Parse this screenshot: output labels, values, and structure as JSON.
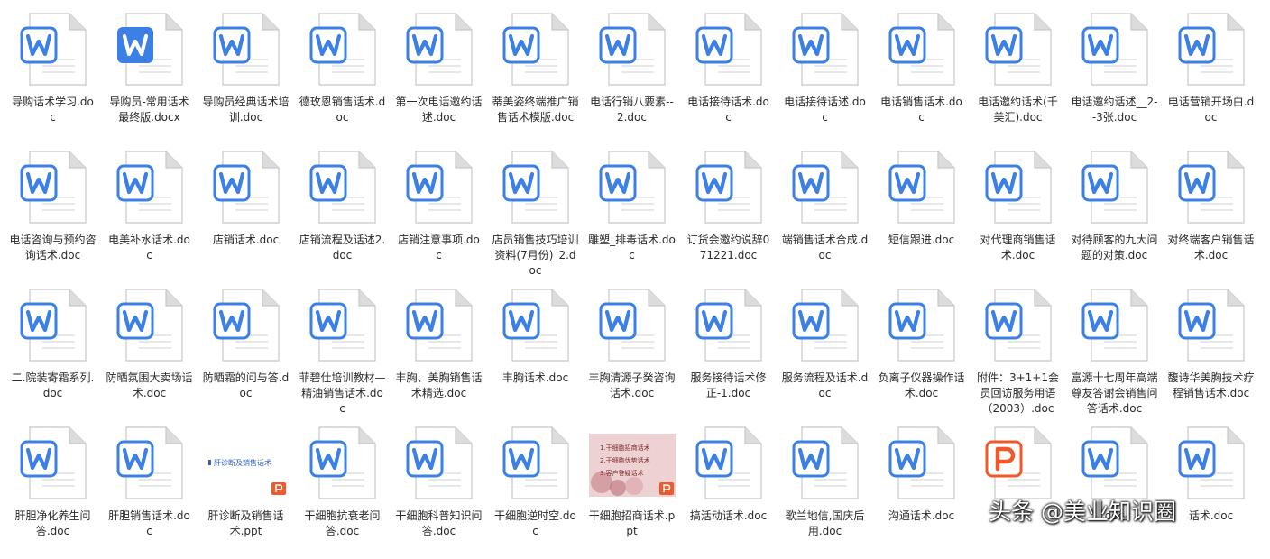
{
  "files": [
    {
      "name": "导购话术学习.doc",
      "type": "word"
    },
    {
      "name": "导购员-常用话术最终版.docx",
      "type": "word-filled"
    },
    {
      "name": "导购员经典话术培训.doc",
      "type": "word"
    },
    {
      "name": "德玫恩销售话术.doc",
      "type": "word"
    },
    {
      "name": "第一次电话邀约话述.doc",
      "type": "word"
    },
    {
      "name": "蒂美姿终端推广销售话术模版.doc",
      "type": "word"
    },
    {
      "name": "电话行销八要素--2.doc",
      "type": "word"
    },
    {
      "name": "电话接待话术.doc",
      "type": "word"
    },
    {
      "name": "电话接待话述.doc",
      "type": "word"
    },
    {
      "name": "电话销售话术.doc",
      "type": "word"
    },
    {
      "name": "电话邀约话术(千美汇).doc",
      "type": "word"
    },
    {
      "name": "电话邀约话述__2--3张.doc",
      "type": "word"
    },
    {
      "name": "电话营销开场白.doc",
      "type": "word"
    },
    {
      "name": "电话咨询与预约咨询话术.doc",
      "type": "word"
    },
    {
      "name": "电美补水话术.doc",
      "type": "word"
    },
    {
      "name": "店销话术.doc",
      "type": "word"
    },
    {
      "name": "店销流程及话述2.doc",
      "type": "word"
    },
    {
      "name": "店销注意事项.doc",
      "type": "word"
    },
    {
      "name": "店员销售技巧培训资料(7月份)_2.doc",
      "type": "word"
    },
    {
      "name": "雕塑_排毒话术.doc",
      "type": "word"
    },
    {
      "name": "订货会邀约说辞071221.doc",
      "type": "word"
    },
    {
      "name": "端销售话术合成.doc",
      "type": "word"
    },
    {
      "name": "短信跟进.doc",
      "type": "word"
    },
    {
      "name": "对代理商销售话术.doc",
      "type": "word"
    },
    {
      "name": "对待顾客的九大问题的对策.doc",
      "type": "word"
    },
    {
      "name": "对终端客户销售话术.doc",
      "type": "word"
    },
    {
      "name": "二.院装寄霜系列.doc",
      "type": "word"
    },
    {
      "name": "防晒氛围大卖场话术.doc",
      "type": "word"
    },
    {
      "name": "防晒霜的问与答.doc",
      "type": "word"
    },
    {
      "name": "菲碧仕培训教材—精油销售话术.doc",
      "type": "word"
    },
    {
      "name": "丰胸、美胸销售话术精选.doc",
      "type": "word"
    },
    {
      "name": "丰胸话术.doc",
      "type": "word"
    },
    {
      "name": "丰胸清源子癸咨询话术.doc",
      "type": "word"
    },
    {
      "name": "服务接待话术修正-1.doc",
      "type": "word"
    },
    {
      "name": "服务流程及话术.doc",
      "type": "word"
    },
    {
      "name": "负离子仪器操作话术.doc",
      "type": "word"
    },
    {
      "name": "附件：3+1+1会员回访服务用语（2003）.doc",
      "type": "word"
    },
    {
      "name": "富源十七周年高端尊友答谢会销售问答话术.doc",
      "type": "word"
    },
    {
      "name": "馥诗华美胸技术疗程销售话术.doc",
      "type": "word"
    },
    {
      "name": "肝胆净化养生问答.doc",
      "type": "word"
    },
    {
      "name": "肝胆销售话术.doc",
      "type": "word"
    },
    {
      "name": "肝诊断及销售话术.ppt",
      "type": "ppt-thumb-white",
      "thumb_text": "肝诊断及销售话术"
    },
    {
      "name": "干细胞抗衰老问答.doc",
      "type": "word"
    },
    {
      "name": "干细胞科普知识问答.doc",
      "type": "word"
    },
    {
      "name": "干细胞逆时空.doc",
      "type": "word"
    },
    {
      "name": "干细胞招商话术.ppt",
      "type": "ppt-thumb-pink",
      "thumb_lines": [
        "1.干细胞招商话术",
        "2.干细胞优势话术",
        "3.客户答疑话术"
      ]
    },
    {
      "name": "搞活动话术.doc",
      "type": "word"
    },
    {
      "name": "歌兰地信,国庆后用.doc",
      "type": "word"
    },
    {
      "name": "沟通话术.doc",
      "type": "word"
    },
    {
      "name": "",
      "type": "ppt"
    },
    {
      "name": "doc",
      "type": "word"
    },
    {
      "name": "话术.doc",
      "type": "word"
    }
  ],
  "watermark": "头条 @美业知识圈",
  "colors": {
    "word_blue": "#3c80e6",
    "ppt_orange": "#f0592a",
    "page_gray": "#c8c8c8",
    "fold": "#dcdcdc"
  }
}
